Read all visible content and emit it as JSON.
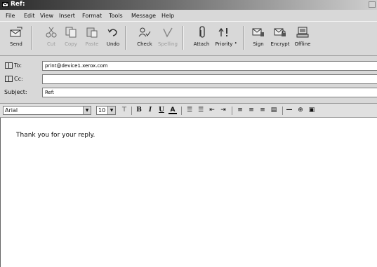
{
  "window": {
    "title": "Ref:"
  },
  "menu": [
    "File",
    "Edit",
    "View",
    "Insert",
    "Format",
    "Tools",
    "Message",
    "Help"
  ],
  "toolbar": {
    "send": "Send",
    "cut": "Cut",
    "copy": "Copy",
    "paste": "Paste",
    "undo": "Undo",
    "check": "Check",
    "spelling": "Spelling",
    "attach": "Attach",
    "priority": "Priority",
    "sign": "Sign",
    "encrypt": "Encrypt",
    "offline": "Offline"
  },
  "header": {
    "to_label": "To:",
    "to_value": "print@device1.xerox.com",
    "cc_label": "Cc:",
    "cc_value": "",
    "subject_label": "Subject:",
    "subject_value": "Ref:"
  },
  "format": {
    "font": "Arial",
    "size": "10"
  },
  "body": {
    "text": "Thank you for your reply."
  }
}
